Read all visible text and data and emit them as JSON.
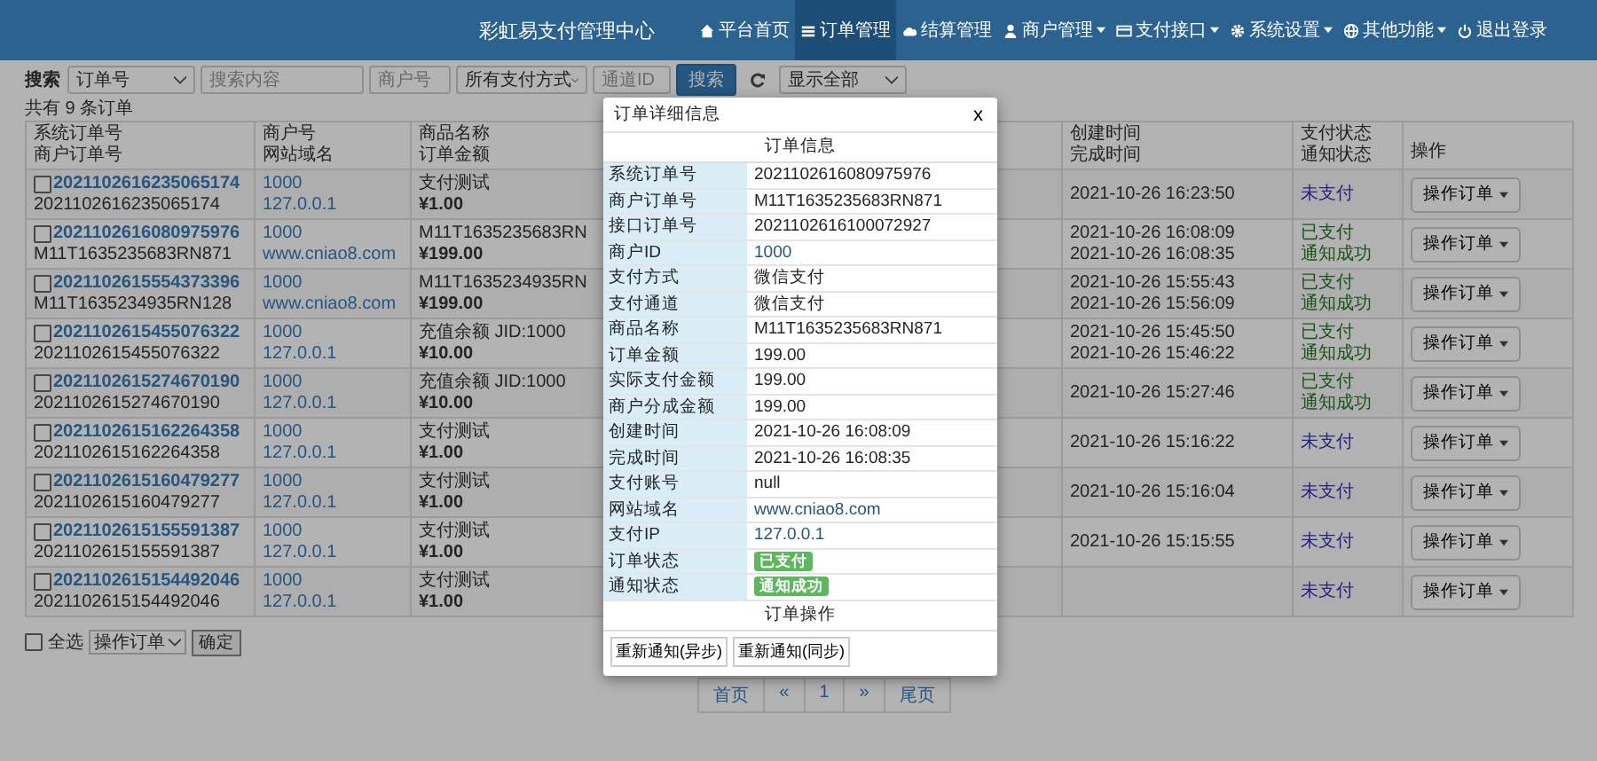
{
  "nav": {
    "brand": "彩虹易支付管理中心",
    "items": [
      {
        "label": "平台首页",
        "selected": false,
        "dropdown": false
      },
      {
        "label": "订单管理",
        "selected": true,
        "dropdown": false
      },
      {
        "label": "结算管理",
        "selected": false,
        "dropdown": false
      },
      {
        "label": "商户管理",
        "selected": false,
        "dropdown": true
      },
      {
        "label": "支付接口",
        "selected": false,
        "dropdown": true
      },
      {
        "label": "系统设置",
        "selected": false,
        "dropdown": true
      },
      {
        "label": "其他功能",
        "selected": false,
        "dropdown": true
      },
      {
        "label": "退出登录",
        "selected": false,
        "dropdown": false
      }
    ]
  },
  "search": {
    "label": "搜索",
    "type_select": "订单号",
    "keyword_placeholder": "搜索内容",
    "merchant_placeholder": "商户号",
    "method_select": "所有支付方式",
    "channel_placeholder": "通道ID",
    "button": "搜索",
    "filter_select": "显示全部"
  },
  "count_text": "共有 9 条订单",
  "table": {
    "columns": [
      [
        "系统订单号",
        "商户订单号"
      ],
      [
        "商户号",
        "网站域名"
      ],
      [
        "商品名称",
        "订单金额"
      ],
      [
        "创建时间",
        "完成时间"
      ],
      [
        "支付状态",
        "通知状态"
      ],
      [
        "操作"
      ]
    ],
    "rows": [
      {
        "checked": false,
        "trade_no": "2021102616235065174",
        "out_trade_no": "2021102616235065174",
        "merchant": "1000",
        "domain": "127.0.0.1",
        "product": "支付测试",
        "amount": "¥1.00",
        "created": "2021-10-26 16:23:50",
        "pay_status": "未支付",
        "color": "#242483",
        "action": "操作订单"
      },
      {
        "checked": false,
        "trade_no": "2021102616080975976",
        "out_trade_no": "M11T1635235683RN871",
        "merchant": "1000",
        "domain": "www.cniao8.com",
        "product": "M11T1635235683RN",
        "amount": "¥199.00",
        "created": "2021-10-26 16:08:09",
        "finished": "2021-10-26 16:08:35",
        "pay_status": "已支付",
        "color": "#185318",
        "notify_status": "通知成功",
        "action": "操作订单"
      },
      {
        "checked": false,
        "trade_no": "2021102615554373396",
        "out_trade_no": "M11T1635234935RN128",
        "merchant": "1000",
        "domain": "www.cniao8.com",
        "product": "M11T1635234935RN",
        "amount": "¥199.00",
        "created": "2021-10-26 15:55:43",
        "finished": "2021-10-26 15:56:09",
        "pay_status": "已支付",
        "color": "#185318",
        "notify_status": "通知成功",
        "action": "操作订单"
      },
      {
        "checked": false,
        "trade_no": "2021102615455076322",
        "out_trade_no": "2021102615455076322",
        "merchant": "1000",
        "domain": "127.0.0.1",
        "product": "充值余额 JID:1000",
        "amount": "¥10.00",
        "created": "2021-10-26 15:45:50",
        "finished": "2021-10-26 15:46:22",
        "pay_status": "已支付",
        "color": "#185318",
        "notify_status": "通知成功",
        "action": "操作订单"
      },
      {
        "checked": false,
        "trade_no": "2021102615274670190",
        "out_trade_no": "2021102615274670190",
        "merchant": "1000",
        "domain": "127.0.0.1",
        "product": "充值余额 JID:1000",
        "amount": "¥10.00",
        "created": "2021-10-26 15:27:46",
        "pay_status": "已支付",
        "color": "#185318",
        "notify_status": "通知成功",
        "action": "操作订单"
      },
      {
        "checked": false,
        "trade_no": "2021102615162264358",
        "out_trade_no": "2021102615162264358",
        "merchant": "1000",
        "domain": "127.0.0.1",
        "product": "支付测试",
        "amount": "¥1.00",
        "created": "2021-10-26 15:16:22",
        "pay_status": "未支付",
        "color": "#242483",
        "action": "操作订单"
      },
      {
        "checked": false,
        "trade_no": "2021102615160479277",
        "out_trade_no": "2021102615160479277",
        "merchant": "1000",
        "domain": "127.0.0.1",
        "product": "支付测试",
        "amount": "¥1.00",
        "created": "2021-10-26 15:16:04",
        "pay_status": "未支付",
        "color": "#242483",
        "action": "操作订单"
      },
      {
        "checked": false,
        "trade_no": "2021102615155591387",
        "out_trade_no": "2021102615155591387",
        "merchant": "1000",
        "domain": "127.0.0.1",
        "product": "支付测试",
        "amount": "¥1.00",
        "created": "2021-10-26 15:15:55",
        "pay_status": "未支付",
        "color": "#242483",
        "action": "操作订单"
      },
      {
        "checked": false,
        "trade_no": "2021102615154492046",
        "out_trade_no": "2021102615154492046",
        "merchant": "1000",
        "domain": "127.0.0.1",
        "product": "支付测试",
        "amount": "¥1.00",
        "pay_status": "未支付",
        "color": "#242483",
        "action": "操作订单"
      }
    ]
  },
  "bulk": {
    "select_all_label": "全选",
    "select_all_checked": false,
    "action_select": "操作订单",
    "confirm_button": "确定"
  },
  "pagination": [
    "首页",
    "«",
    "1",
    "»",
    "尾页"
  ],
  "modal": {
    "title": "订单详细信息",
    "close": "x",
    "section_title": "订单信息",
    "fields": [
      {
        "label": "系统订单号",
        "value": "2021102616080975976",
        "kind": "text"
      },
      {
        "label": "商户订单号",
        "value": "M11T1635235683RN871",
        "kind": "text"
      },
      {
        "label": "接口订单号",
        "value": "2021102616100072927",
        "kind": "text"
      },
      {
        "label": "商户ID",
        "value": "1000",
        "kind": "link"
      },
      {
        "label": "支付方式",
        "value": "微信支付",
        "kind": "text"
      },
      {
        "label": "支付通道",
        "value": "微信支付",
        "kind": "text"
      },
      {
        "label": "商品名称",
        "value": "M11T1635235683RN871",
        "kind": "text"
      },
      {
        "label": "订单金额",
        "value": "199.00",
        "kind": "text"
      },
      {
        "label": "实际支付金额",
        "value": "199.00",
        "kind": "text"
      },
      {
        "label": "商户分成金额",
        "value": "199.00",
        "kind": "text"
      },
      {
        "label": "创建时间",
        "value": "2021-10-26 16:08:09",
        "kind": "text"
      },
      {
        "label": "完成时间",
        "value": "2021-10-26 16:08:35",
        "kind": "text"
      },
      {
        "label": "支付账号",
        "value": "null",
        "kind": "text"
      },
      {
        "label": "网站域名",
        "value": "www.cniao8.com",
        "kind": "link"
      },
      {
        "label": "支付IP",
        "value": "127.0.0.1",
        "kind": "link"
      },
      {
        "label": "订单状态",
        "value": "已支付",
        "kind": "badge"
      },
      {
        "label": "通知状态",
        "value": "通知成功",
        "kind": "badge"
      }
    ],
    "actions_title": "订单操作",
    "actions": [
      "重新通知(异步)",
      "重新通知(同步)"
    ]
  }
}
